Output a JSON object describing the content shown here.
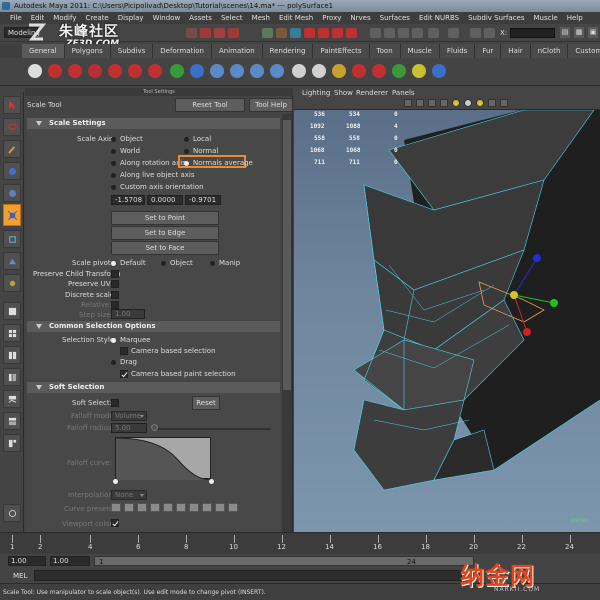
{
  "window": {
    "title": "Autodesk Maya 2011: C:\\Users\\Picipolivad\\Desktop\\Tutorial\\scenes\\14.ma* --- polySurface1"
  },
  "menubar": [
    "File",
    "Edit",
    "Modify",
    "Create",
    "Display",
    "Window",
    "Assets",
    "Select",
    "Mesh",
    "Edit Mesh",
    "Proxy",
    "Nrves",
    "Surfaces",
    "Edit NURBS",
    "Subdiv Surfaces",
    "Muscle",
    "Help"
  ],
  "statusline": {
    "mode": "Modeling",
    "x_label": "X:"
  },
  "watermark_top": {
    "cn": "朱峰社区",
    "en": "ZF3D.COM"
  },
  "shelf": {
    "tabs": [
      "General",
      "Polygons",
      "Subdivs",
      "Deformation",
      "Animation",
      "Rendering",
      "PaintEffects",
      "Toon",
      "Muscle",
      "Fluids",
      "Fur",
      "Hair",
      "nCloth",
      "Custom"
    ]
  },
  "tool_settings": {
    "header": "Tool Settings",
    "tool_name": "Scale Tool",
    "reset_label": "Reset Tool",
    "help_label": "Tool Help",
    "scale_settings": {
      "title": "Scale Settings",
      "axis_label": "Scale Axis:",
      "options": {
        "object": "Object",
        "local": "Local",
        "world": "World",
        "normal": "Normal",
        "rotation": "Along rotation axis",
        "normals_avg": "Normals average",
        "live": "Along live object axis",
        "custom": "Custom axis orientation"
      },
      "custom_values": [
        "-1.5708",
        "0.0000",
        "-0.9701"
      ],
      "set_point": "Set to Point",
      "set_edge": "Set to Edge",
      "set_face": "Set to Face",
      "pivot_label": "Scale pivot:",
      "pivot_default": "Default",
      "pivot_object": "Object",
      "pivot_manip": "Manip",
      "preserve_child": "Preserve Child Transform",
      "preserve_uvs": "Preserve UVs",
      "discrete": "Discrete scale:",
      "relative": "Relative:",
      "step_label": "Step size:",
      "step_value": "1.00"
    },
    "common_selection": {
      "title": "Common Selection Options",
      "style_label": "Selection Style:",
      "marquee": "Marquee",
      "camera_based": "Camera based selection",
      "drag": "Drag",
      "camera_paint": "Camera based paint selection"
    },
    "soft_selection": {
      "title": "Soft Selection",
      "soft_select": "Soft Select:",
      "reset": "Reset",
      "falloff_mode": "Falloff mode:",
      "falloff_mode_value": "Volume",
      "falloff_radius": "Falloff radius:",
      "falloff_radius_value": "5.00",
      "falloff_curve": "Falloff curve:",
      "interpolation": "Interpolation:",
      "interpolation_value": "None",
      "curve_presets": "Curve presets:",
      "viewport_color": "Viewport color:"
    }
  },
  "viewport": {
    "menus": [
      "Lighting",
      "Show",
      "Renderer",
      "Panels"
    ],
    "hud": [
      [
        "536",
        "534",
        "0"
      ],
      [
        "1092",
        "1088",
        "4"
      ],
      [
        "558",
        "558",
        "0"
      ],
      [
        "1068",
        "1068",
        "0"
      ],
      [
        "711",
        "711",
        "0"
      ]
    ],
    "corner": "persp",
    "colors": {
      "sky_top": "#5a6f87",
      "wire": "#4ad2e6",
      "mesh": "#3b3b3b",
      "pivot_x": "#d62020",
      "pivot_y": "#20c020",
      "pivot_z": "#2030d0",
      "center": "#d6c420"
    }
  },
  "timeline": {
    "ticks": [
      "1",
      "2",
      "4",
      "6",
      "8",
      "10",
      "12",
      "14",
      "16",
      "18",
      "20",
      "22",
      "24"
    ],
    "range_start": "1.00",
    "range_inner": "1.00",
    "range_value": "1",
    "range_end": "24"
  },
  "command": {
    "label": "MEL"
  },
  "help": {
    "text": "Scale Tool: Use manipulator to scale object(s). Use edit mode to change pivot (INSERT)."
  },
  "watermark_br": {
    "cn": "纳金网",
    "en": "NARKII.COM"
  },
  "accent": {
    "highlight": "#ee8833",
    "active_tool": "#f0a030"
  }
}
